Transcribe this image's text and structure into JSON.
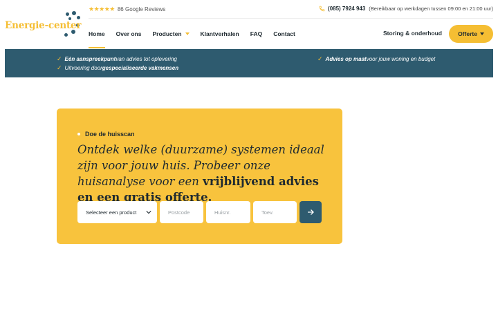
{
  "header": {
    "logo_text": "Energie-center",
    "reviews": {
      "stars": "★★★★★",
      "label": "86 Google Reviews"
    },
    "phone": {
      "number": "(085) 7924 943",
      "hours": "(Bereikbaar op werkdagen tussen 09:00 en 21:00 uur)"
    },
    "nav": [
      {
        "label": "Home",
        "active": true
      },
      {
        "label": "Over ons"
      },
      {
        "label": "Producten",
        "has_dropdown": true
      },
      {
        "label": "Klantverhalen"
      },
      {
        "label": "FAQ"
      },
      {
        "label": "Contact"
      }
    ],
    "service_link": "Storing & onderhoud",
    "cta_label": "Offerte"
  },
  "band": {
    "usps": [
      {
        "bold": "Eén aanspreekpunt",
        "rest": " van advies tot oplevering"
      },
      {
        "pre": "Uitvoering door ",
        "bold": "gespecialiseerde vakmensen"
      },
      {
        "bold": "Advies op maat",
        "rest": " voor jouw woning en budget"
      }
    ]
  },
  "scan": {
    "eyebrow": "Doe de huisscan",
    "headline_regular": "Ontdek welke (duurzame) systemen ideaal zijn voor jouw huis. Probeer onze huisanalyse voor een ",
    "headline_bold": "vrijblijvend advies en een gratis offerte.",
    "product_select": "Selecteer een product",
    "postcode_placeholder": "Postcode",
    "huisnr_placeholder": "Huisnr.",
    "toev_placeholder": "Toev."
  },
  "colors": {
    "accent": "#f5be33",
    "brand": "#2e5b6f",
    "card": "#f8c33d"
  }
}
